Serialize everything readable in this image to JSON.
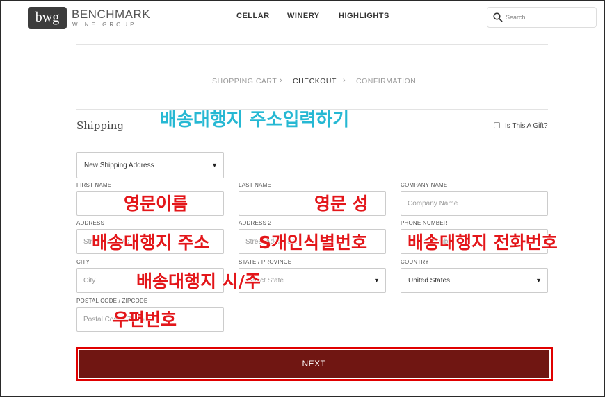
{
  "header": {
    "logo_mark": "bwg",
    "logo_name": "BENCHMARK",
    "logo_sub": "WINE GROUP",
    "nav": [
      "CELLAR",
      "WINERY",
      "HIGHLIGHTS"
    ],
    "search_placeholder": "Search"
  },
  "steps": [
    "SHOPPING CART",
    "CHECKOUT",
    "CONFIRMATION"
  ],
  "step_separator": "›",
  "shipping": {
    "title": "Shipping",
    "gift_label": "Is This A Gift?",
    "address_select": "New Shipping Address",
    "first_name_label": "FIRST NAME",
    "last_name_label": "LAST NAME",
    "company_label": "COMPANY NAME",
    "company_placeholder": "Company Name",
    "address_label": "ADDRESS",
    "address_placeholder": "Street Address",
    "address2_label": "ADDRESS 2",
    "address2_placeholder": "Street Address 2",
    "phone_label": "PHONE NUMBER",
    "phone_placeholder": "Phone Number",
    "city_label": "CITY",
    "city_placeholder": "City",
    "state_label": "STATE / PROVINCE",
    "state_value": "Select State",
    "country_label": "COUNTRY",
    "country_value": "United States",
    "postal_label": "POSTAL CODE / ZIPCODE",
    "postal_placeholder": "Postal Code / Zipcode"
  },
  "next_label": "NEXT",
  "annotations": {
    "title": "배송대행지 주소입력하기",
    "first_name": "영문이름",
    "last_name": "영문 성",
    "address": "배송대행지 주소",
    "address2": "S개인식별번호",
    "phone": "배송대행지 전화번호",
    "city_state": "배송대행지 시/주",
    "postal": "우편번호"
  },
  "colors": {
    "next_button": "#701612",
    "annotation_red": "#e3161a",
    "annotation_cyan": "#26b8d3"
  }
}
